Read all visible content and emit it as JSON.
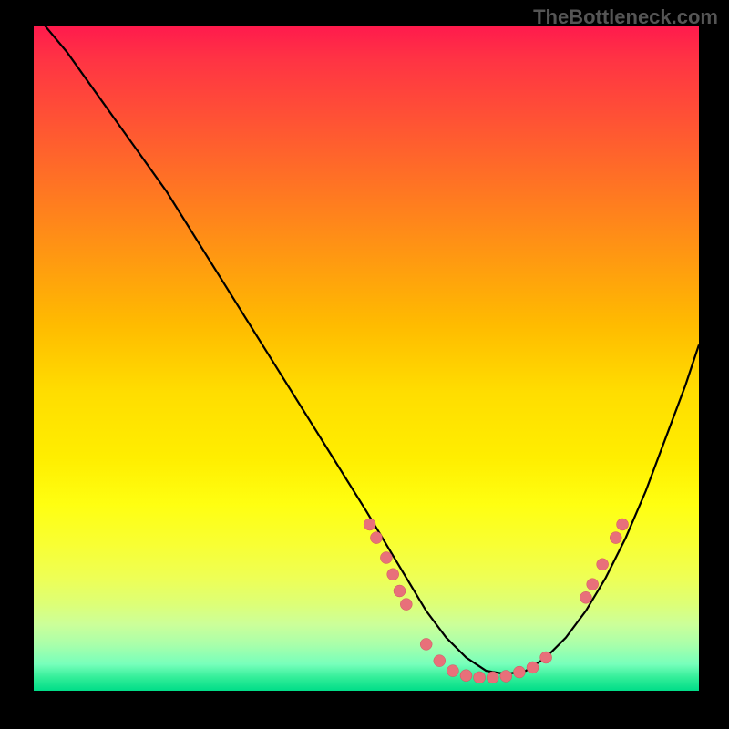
{
  "watermark": "TheBottleneck.com",
  "chart_data": {
    "type": "line",
    "title": "",
    "xlabel": "",
    "ylabel": "",
    "xlim": [
      0,
      100
    ],
    "ylim": [
      0,
      100
    ],
    "curve": {
      "x": [
        0,
        5,
        10,
        15,
        20,
        25,
        30,
        35,
        40,
        45,
        50,
        53,
        56,
        59,
        62,
        65,
        68,
        71,
        74,
        77,
        80,
        83,
        86,
        89,
        92,
        95,
        98,
        100
      ],
      "y": [
        102,
        96,
        89,
        82,
        75,
        67,
        59,
        51,
        43,
        35,
        27,
        22,
        17,
        12,
        8,
        5,
        3,
        2.5,
        3,
        5,
        8,
        12,
        17,
        23,
        30,
        38,
        46,
        52
      ]
    },
    "points": [
      {
        "x": 50.5,
        "y": 25
      },
      {
        "x": 51.5,
        "y": 23
      },
      {
        "x": 53,
        "y": 20
      },
      {
        "x": 54,
        "y": 17.5
      },
      {
        "x": 55,
        "y": 15
      },
      {
        "x": 56,
        "y": 13
      },
      {
        "x": 59,
        "y": 7
      },
      {
        "x": 61,
        "y": 4.5
      },
      {
        "x": 63,
        "y": 3
      },
      {
        "x": 65,
        "y": 2.3
      },
      {
        "x": 67,
        "y": 2
      },
      {
        "x": 69,
        "y": 2
      },
      {
        "x": 71,
        "y": 2.2
      },
      {
        "x": 73,
        "y": 2.8
      },
      {
        "x": 75,
        "y": 3.5
      },
      {
        "x": 77,
        "y": 5
      },
      {
        "x": 83,
        "y": 14
      },
      {
        "x": 84,
        "y": 16
      },
      {
        "x": 85.5,
        "y": 19
      },
      {
        "x": 87.5,
        "y": 23
      },
      {
        "x": 88.5,
        "y": 25
      }
    ],
    "gradient_description": "vertical gradient red (top) through orange, yellow, to green (bottom) representing bottleneck severity"
  }
}
